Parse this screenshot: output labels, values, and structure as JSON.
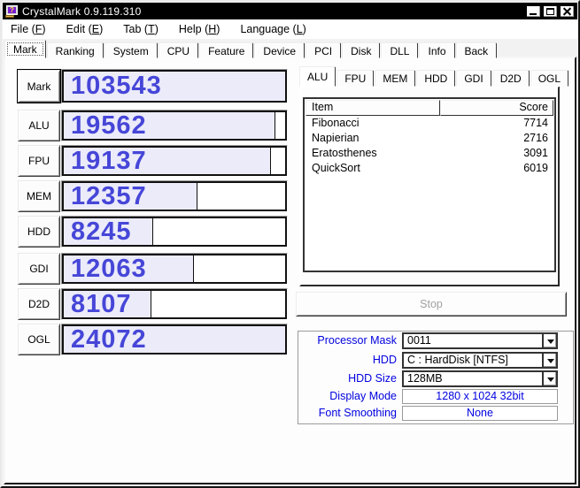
{
  "window": {
    "title": "CrystalMark 0.9.119.310",
    "app_icon_glyph": "?",
    "controls": [
      "minimize",
      "maximize",
      "close"
    ]
  },
  "menu": {
    "items": [
      {
        "pre": "File (",
        "key": "F",
        "post": ")"
      },
      {
        "pre": "Edit (",
        "key": "E",
        "post": ")"
      },
      {
        "pre": "Tab (",
        "key": "T",
        "post": ")"
      },
      {
        "pre": "Help (",
        "key": "H",
        "post": ")"
      },
      {
        "pre": "Language (",
        "key": "L",
        "post": ")"
      }
    ]
  },
  "main_tabs": {
    "selected": "Mark",
    "items": [
      "Mark",
      "Ranking",
      "System",
      "CPU",
      "Feature",
      "Device",
      "PCI",
      "Disk",
      "DLL",
      "Info",
      "Back"
    ]
  },
  "scores": {
    "scale_max": 20480,
    "rows": [
      {
        "label": "Mark",
        "value": 103543
      },
      {
        "label": "ALU",
        "value": 19562
      },
      {
        "label": "FPU",
        "value": 19137
      },
      {
        "label": "MEM",
        "value": 12357
      },
      {
        "label": "HDD",
        "value": 8245
      },
      {
        "label": "GDI",
        "value": 12063
      },
      {
        "label": "D2D",
        "value": 8107
      },
      {
        "label": "OGL",
        "value": 24072
      }
    ]
  },
  "detail": {
    "selected": "ALU",
    "tabs": [
      "ALU",
      "FPU",
      "MEM",
      "HDD",
      "GDI",
      "D2D",
      "OGL"
    ],
    "columns": [
      "Item",
      "Score"
    ],
    "rows": [
      {
        "item": "Fibonacci",
        "score": "7714"
      },
      {
        "item": "Napierian",
        "score": "2716"
      },
      {
        "item": "Eratosthenes",
        "score": "3091"
      },
      {
        "item": "QuickSort",
        "score": "6019"
      }
    ]
  },
  "actions": {
    "stop_label": "Stop"
  },
  "settings": {
    "rows": [
      {
        "label": "Processor Mask",
        "value": "0011",
        "type": "combo"
      },
      {
        "label": "HDD",
        "value": "C : HardDisk [NTFS]",
        "type": "combo"
      },
      {
        "label": "HDD Size",
        "value": "128MB",
        "type": "combo"
      },
      {
        "label": "Display Mode",
        "value": "1280 x 1024 32bit",
        "type": "static"
      },
      {
        "label": "Font Smoothing",
        "value": "None",
        "type": "static"
      }
    ]
  },
  "colors": {
    "titlebar": "#000000",
    "score_number_blue": "#4646D8",
    "bar_fill_lavender": "#EBEBFA",
    "label_blue": "#0000E0"
  }
}
